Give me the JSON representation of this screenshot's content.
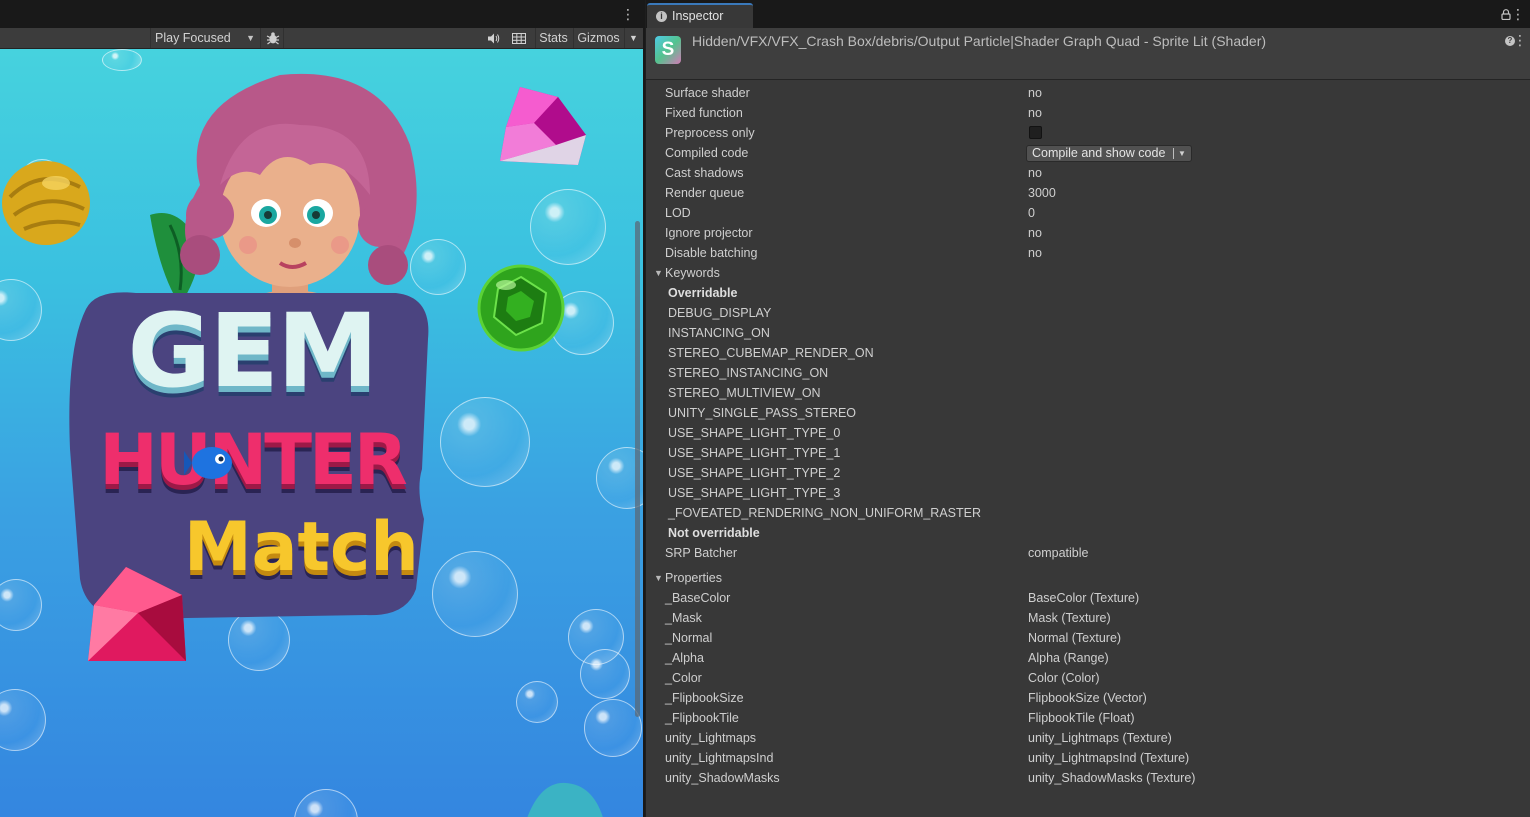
{
  "game_view": {
    "toolbar": {
      "play_mode": "Play Focused",
      "stats": "Stats",
      "gizmos": "Gizmos"
    },
    "logo": {
      "line1": "GEM",
      "line2": "HUNTER",
      "line3": "Match"
    }
  },
  "inspector": {
    "tab_label": "Inspector",
    "title": "Hidden/VFX/VFX_Crash Box/debris/Output Particle|Shader Graph Quad - Sprite Lit (Shader)",
    "rows": [
      {
        "label": "Surface shader",
        "value": "no"
      },
      {
        "label": "Fixed function",
        "value": "no"
      },
      {
        "label": "Preprocess only",
        "value": ""
      },
      {
        "label": "Compiled code",
        "value": "Compile and show code"
      },
      {
        "label": "Cast shadows",
        "value": "no"
      },
      {
        "label": "Render queue",
        "value": "3000"
      },
      {
        "label": "LOD",
        "value": "0"
      },
      {
        "label": "Ignore projector",
        "value": "no"
      },
      {
        "label": "Disable batching",
        "value": "no"
      }
    ],
    "keywords": {
      "label": "Keywords",
      "overridable_label": "Overridable",
      "overridable": [
        "DEBUG_DISPLAY",
        "INSTANCING_ON",
        "STEREO_CUBEMAP_RENDER_ON",
        "STEREO_INSTANCING_ON",
        "STEREO_MULTIVIEW_ON",
        "UNITY_SINGLE_PASS_STEREO",
        "USE_SHAPE_LIGHT_TYPE_0",
        "USE_SHAPE_LIGHT_TYPE_1",
        "USE_SHAPE_LIGHT_TYPE_2",
        "USE_SHAPE_LIGHT_TYPE_3",
        "_FOVEATED_RENDERING_NON_UNIFORM_RASTER"
      ],
      "not_overridable_label": "Not overridable"
    },
    "srp_batcher": {
      "label": "SRP Batcher",
      "value": "compatible"
    },
    "properties": {
      "label": "Properties",
      "items": [
        {
          "name": "_BaseColor",
          "type": "BaseColor (Texture)"
        },
        {
          "name": "_Mask",
          "type": "Mask (Texture)"
        },
        {
          "name": "_Normal",
          "type": "Normal (Texture)"
        },
        {
          "name": "_Alpha",
          "type": "Alpha (Range)"
        },
        {
          "name": "_Color",
          "type": "Color (Color)"
        },
        {
          "name": "_FlipbookSize",
          "type": "FlipbookSize (Vector)"
        },
        {
          "name": "_FlipbookTile",
          "type": "FlipbookTile (Float)"
        },
        {
          "name": "unity_Lightmaps",
          "type": "unity_Lightmaps (Texture)"
        },
        {
          "name": "unity_LightmapsInd",
          "type": "unity_LightmapsInd (Texture)"
        },
        {
          "name": "unity_ShadowMasks",
          "type": "unity_ShadowMasks (Texture)"
        }
      ]
    }
  }
}
